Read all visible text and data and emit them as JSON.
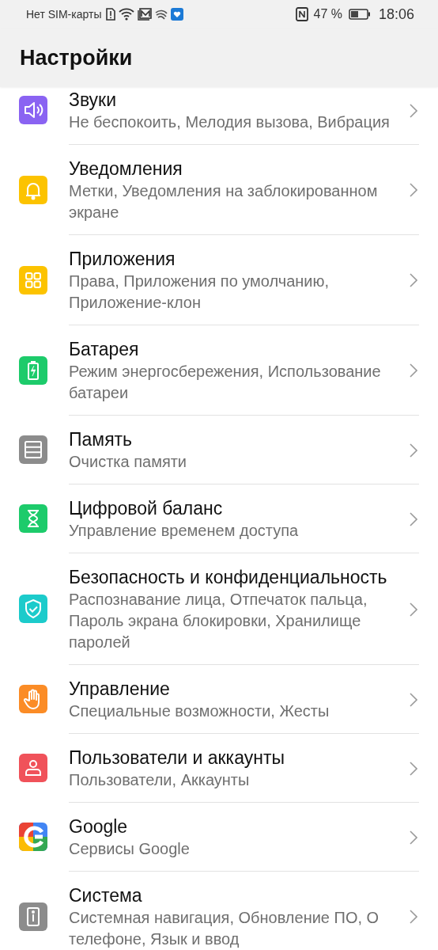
{
  "status_bar": {
    "carrier": "Нет SIM-карты",
    "battery_percent": "47 %",
    "time": "18:06"
  },
  "title": "Настройки",
  "items": [
    {
      "kind": "sound",
      "color": "#8a63f2",
      "title": "Звуки",
      "subtitle": "Не беспокоить, Мелодия вызова, Вибрация"
    },
    {
      "kind": "bell",
      "color": "#fcc300",
      "title": "Уведомления",
      "subtitle": "Метки, Уведомления на заблокированном экране"
    },
    {
      "kind": "apps",
      "color": "#fcc300",
      "title": "Приложения",
      "subtitle": "Права, Приложения по умолчанию, Приложение-клон"
    },
    {
      "kind": "battery",
      "color": "#1dcb6b",
      "title": "Батарея",
      "subtitle": "Режим энергосбережения, Использование батареи"
    },
    {
      "kind": "storage",
      "color": "#8c8c8c",
      "title": "Память",
      "subtitle": "Очистка памяти"
    },
    {
      "kind": "hourglass",
      "color": "#1dcb6b",
      "title": "Цифровой баланс",
      "subtitle": "Управление временем доступа"
    },
    {
      "kind": "shield",
      "color": "#1ccbcb",
      "title": "Безопасность и конфиденциальность",
      "subtitle": "Распознавание лица, Отпечаток пальца, Пароль экрана блокировки, Хранилище паролей"
    },
    {
      "kind": "hand",
      "color": "#fb8c26",
      "title": "Управление",
      "subtitle": "Специальные возможности, Жесты"
    },
    {
      "kind": "user",
      "color": "#f0525a",
      "title": "Пользователи и аккаунты",
      "subtitle": "Пользователи, Аккаунты"
    },
    {
      "kind": "google",
      "color": "#4285f4",
      "title": "Google",
      "subtitle": "Сервисы Google"
    },
    {
      "kind": "phone",
      "color": "#8c8c8c",
      "title": "Система",
      "subtitle": "Системная навигация, Обновление ПО, О телефоне, Язык и ввод"
    }
  ]
}
